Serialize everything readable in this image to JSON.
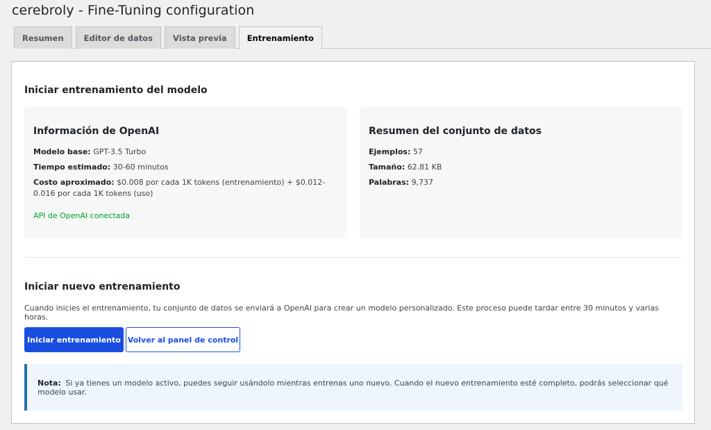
{
  "page": {
    "title": "cerebroly - Fine-Tuning configuration"
  },
  "tabs": [
    {
      "label": "Resumen",
      "active": false
    },
    {
      "label": "Editor de datos",
      "active": false
    },
    {
      "label": "Vista previa",
      "active": false
    },
    {
      "label": "Entrenamiento",
      "active": true
    }
  ],
  "main": {
    "heading": "Iniciar entrenamiento del modelo",
    "openai_card": {
      "title": "Información de OpenAI",
      "base_model_label": "Modelo base:",
      "base_model_value": "GPT-3.5 Turbo",
      "time_label": "Tiempo estimado:",
      "time_value": "30-60 minutos",
      "cost_label": "Costo aproximado:",
      "cost_value": "$0.008 por cada 1K tokens (entrenamiento) + $0.012-0.016 por cada 1K tokens (uso)",
      "api_status": "API de OpenAI conectada"
    },
    "dataset_card": {
      "title": "Resumen del conjunto de datos",
      "examples_label": "Ejemplos:",
      "examples_value": "57",
      "size_label": "Tamaño:",
      "size_value": "62.81 KB",
      "words_label": "Palabras:",
      "words_value": "9,737"
    },
    "new_training": {
      "heading": "Iniciar nuevo entrenamiento",
      "description": "Cuando inicies el entrenamiento, tu conjunto de datos se enviará a OpenAI para crear un modelo personalizado. Este proceso puede tardar entre 30 minutos y varias horas.",
      "start_button": "Iniciar entrenamiento",
      "back_button": "Volver al panel de control"
    },
    "notice": {
      "label": "Nota:",
      "text": "Si ya tienes un modelo activo, puedes seguir usándolo mientras entrenas uno nuevo. Cuando el nuevo entrenamiento esté completo, podrás seleccionar qué modelo usar."
    }
  },
  "colors": {
    "primary": "#1a4ee0",
    "success": "#00a32a",
    "notice_border": "#2271b1"
  }
}
